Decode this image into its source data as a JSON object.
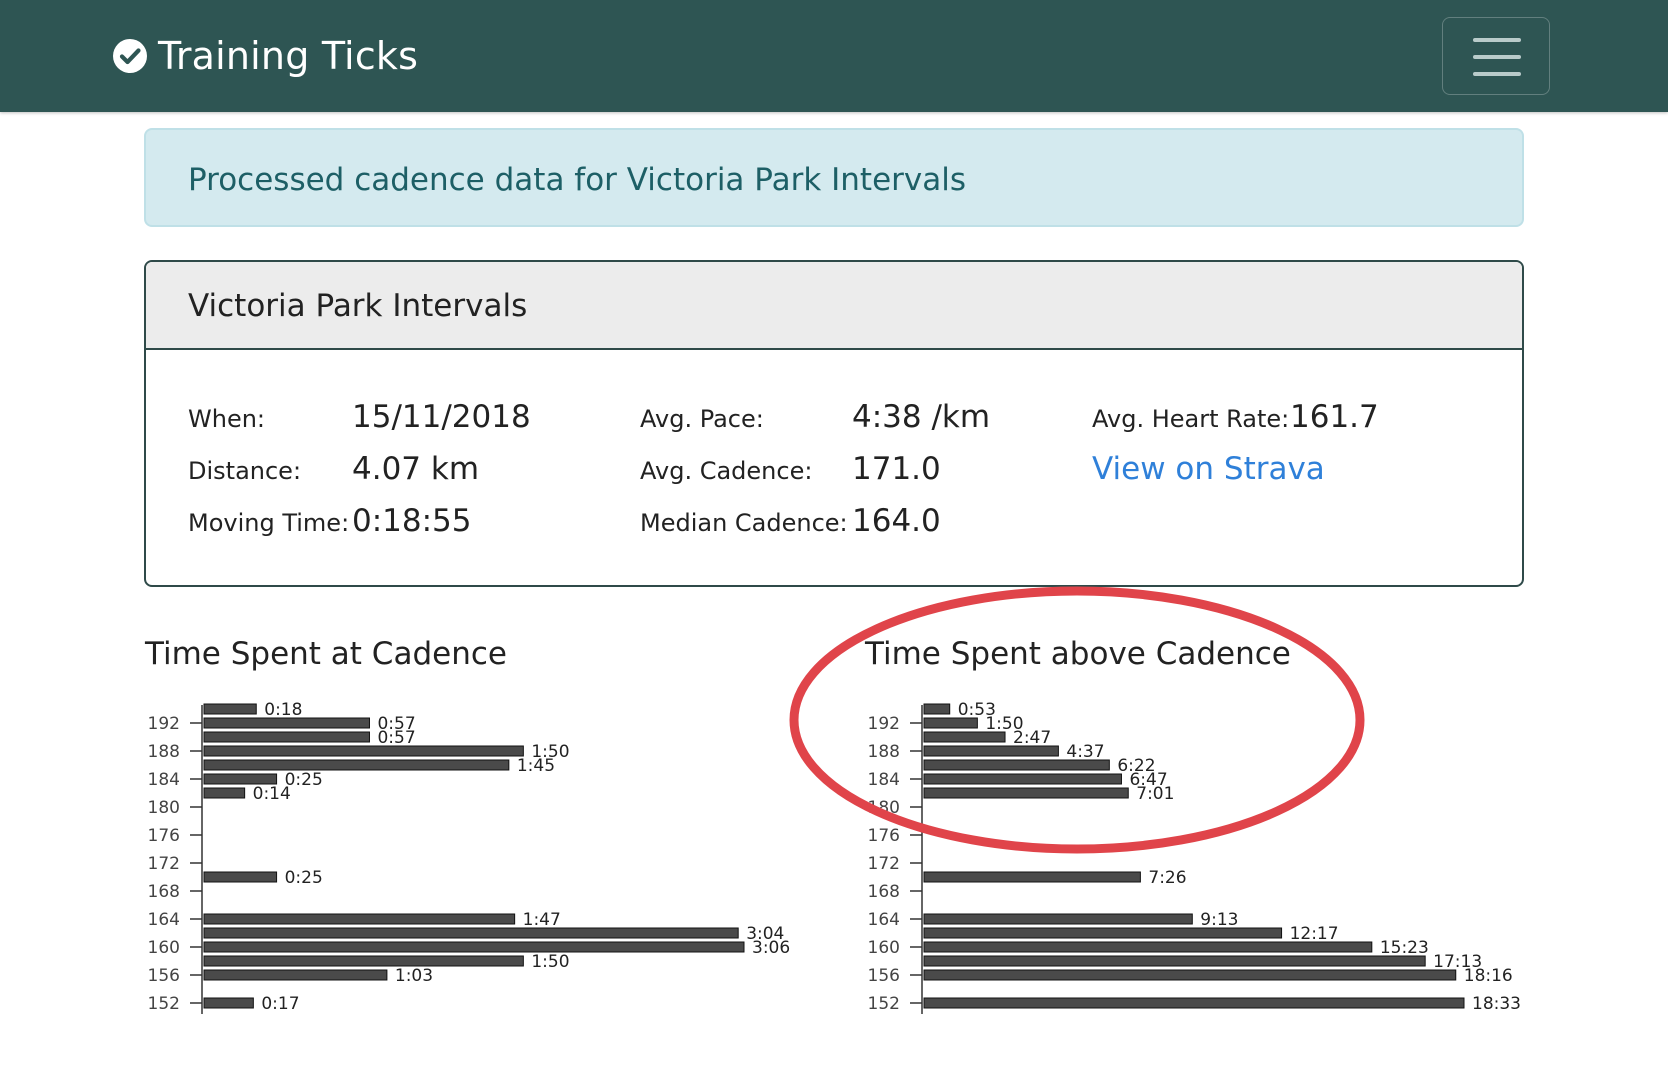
{
  "navbar": {
    "brand": "Training Ticks",
    "brand_icon": "check-circle-icon",
    "menu_icon": "hamburger-menu-icon",
    "background": "#2e5553"
  },
  "alert": {
    "text": "Processed cadence data for Victoria Park Intervals"
  },
  "activity": {
    "title": "Victoria Park Intervals",
    "when_label": "When:",
    "when": "15/11/2018",
    "distance_label": "Distance:",
    "distance": "4.07 km",
    "moving_time_label": "Moving Time:",
    "moving_time": "0:18:55",
    "pace_label": "Avg. Pace:",
    "pace": "4:38 /km",
    "cadence_label": "Avg. Cadence:",
    "cadence": "171.0",
    "median_label": "Median Cadence:",
    "median": "164.0",
    "hr_label": "Avg. Heart Rate:",
    "hr": "161.7",
    "strava_link": "View on Strava"
  },
  "chart_data": [
    {
      "type": "bar",
      "orientation": "horizontal",
      "title": "Time Spent at Cadence",
      "yticks": [
        192,
        188,
        184,
        180,
        176,
        172,
        168,
        164,
        160,
        156,
        152
      ],
      "ylim": [
        151,
        194
      ],
      "bars": [
        {
          "cadence": 194,
          "seconds": 18,
          "label": "0:18"
        },
        {
          "cadence": 192,
          "seconds": 57,
          "label": "0:57"
        },
        {
          "cadence": 190,
          "seconds": 57,
          "label": "0:57"
        },
        {
          "cadence": 188,
          "seconds": 110,
          "label": "1:50"
        },
        {
          "cadence": 186,
          "seconds": 105,
          "label": "1:45"
        },
        {
          "cadence": 184,
          "seconds": 25,
          "label": "0:25"
        },
        {
          "cadence": 182,
          "seconds": 14,
          "label": "0:14"
        },
        {
          "cadence": 170,
          "seconds": 25,
          "label": "0:25"
        },
        {
          "cadence": 164,
          "seconds": 107,
          "label": "1:47"
        },
        {
          "cadence": 162,
          "seconds": 184,
          "label": "3:04"
        },
        {
          "cadence": 160,
          "seconds": 186,
          "label": "3:06"
        },
        {
          "cadence": 158,
          "seconds": 110,
          "label": "1:50"
        },
        {
          "cadence": 156,
          "seconds": 63,
          "label": "1:03"
        },
        {
          "cadence": 152,
          "seconds": 17,
          "label": "0:17"
        }
      ],
      "color": "#4a4a4a"
    },
    {
      "type": "bar",
      "orientation": "horizontal",
      "title": "Time Spent above Cadence",
      "yticks": [
        192,
        188,
        184,
        180,
        176,
        172,
        168,
        164,
        160,
        156,
        152
      ],
      "ylim": [
        151,
        194
      ],
      "bars": [
        {
          "cadence": 194,
          "seconds": 53,
          "label": "0:53"
        },
        {
          "cadence": 192,
          "seconds": 110,
          "label": "1:50"
        },
        {
          "cadence": 190,
          "seconds": 167,
          "label": "2:47"
        },
        {
          "cadence": 188,
          "seconds": 277,
          "label": "4:37"
        },
        {
          "cadence": 186,
          "seconds": 382,
          "label": "6:22"
        },
        {
          "cadence": 184,
          "seconds": 407,
          "label": "6:47"
        },
        {
          "cadence": 182,
          "seconds": 421,
          "label": "7:01"
        },
        {
          "cadence": 170,
          "seconds": 446,
          "label": "7:26"
        },
        {
          "cadence": 164,
          "seconds": 553,
          "label": "9:13"
        },
        {
          "cadence": 162,
          "seconds": 737,
          "label": "12:17"
        },
        {
          "cadence": 160,
          "seconds": 923,
          "label": "15:23"
        },
        {
          "cadence": 158,
          "seconds": 1033,
          "label": "17:13"
        },
        {
          "cadence": 156,
          "seconds": 1096,
          "label": "18:16"
        },
        {
          "cadence": 152,
          "seconds": 1113,
          "label": "18:33"
        }
      ],
      "color": "#4a4a4a"
    }
  ],
  "annotation": {
    "shape": "ellipse",
    "color": "#e0444a",
    "target": "Time Spent above Cadence"
  }
}
